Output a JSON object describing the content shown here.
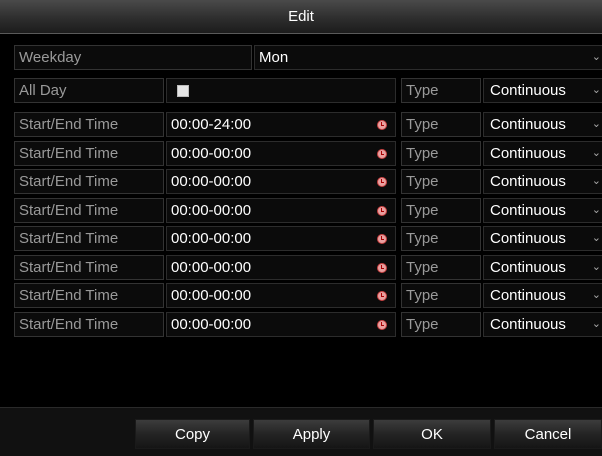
{
  "dialog": {
    "title": "Edit"
  },
  "weekday": {
    "label": "Weekday",
    "value": "Mon"
  },
  "all_day": {
    "label": "All Day",
    "checked": false,
    "type_label": "Type",
    "type_value": "Continuous"
  },
  "schedule": [
    {
      "label": "Start/End Time",
      "time": "00:00-24:00",
      "type_label": "Type",
      "type_value": "Continuous"
    },
    {
      "label": "Start/End Time",
      "time": "00:00-00:00",
      "type_label": "Type",
      "type_value": "Continuous"
    },
    {
      "label": "Start/End Time",
      "time": "00:00-00:00",
      "type_label": "Type",
      "type_value": "Continuous"
    },
    {
      "label": "Start/End Time",
      "time": "00:00-00:00",
      "type_label": "Type",
      "type_value": "Continuous"
    },
    {
      "label": "Start/End Time",
      "time": "00:00-00:00",
      "type_label": "Type",
      "type_value": "Continuous"
    },
    {
      "label": "Start/End Time",
      "time": "00:00-00:00",
      "type_label": "Type",
      "type_value": "Continuous"
    },
    {
      "label": "Start/End Time",
      "time": "00:00-00:00",
      "type_label": "Type",
      "type_value": "Continuous"
    },
    {
      "label": "Start/End Time",
      "time": "00:00-00:00",
      "type_label": "Type",
      "type_value": "Continuous"
    }
  ],
  "buttons": {
    "copy": "Copy",
    "apply": "Apply",
    "ok": "OK",
    "cancel": "Cancel"
  },
  "icons": {
    "clock": "clock-icon",
    "dropdown": "chevron-down-icon",
    "checkbox": "checkbox-icon"
  }
}
